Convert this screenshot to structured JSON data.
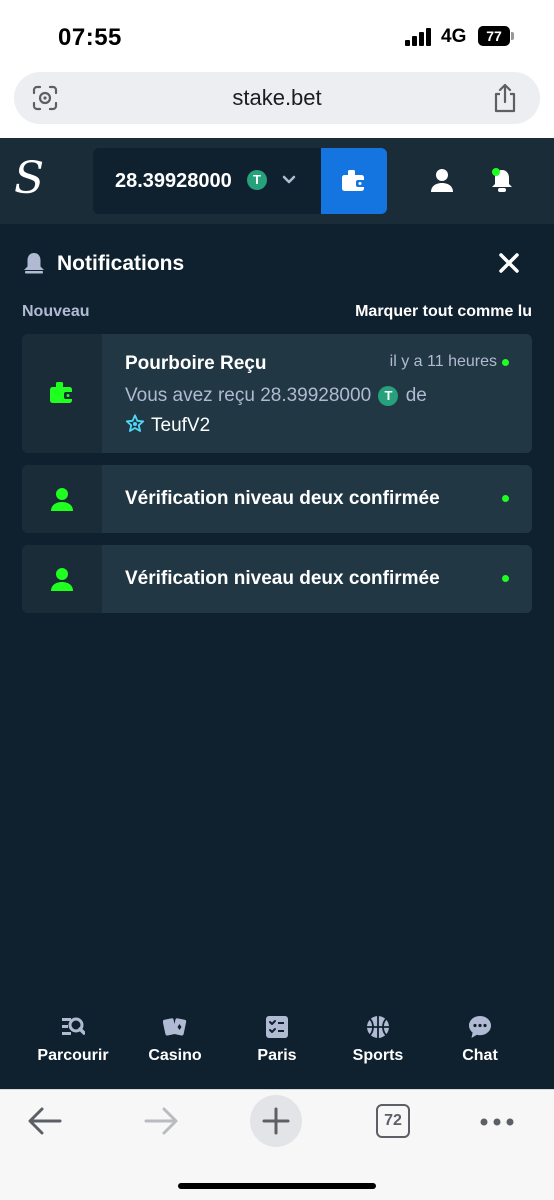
{
  "status_bar": {
    "time": "07:55",
    "network": "4G",
    "battery": "77"
  },
  "browser": {
    "url": "stake.bet",
    "tab_count": "72"
  },
  "header": {
    "logo": "S",
    "balance": "28.39928000",
    "currency_symbol": "T"
  },
  "notifications": {
    "title": "Notifications",
    "section_label": "Nouveau",
    "mark_all_read": "Marquer tout comme lu",
    "items": [
      {
        "title": "Pourboire Reçu",
        "time": "il y a 11 heures",
        "body_prefix": "Vous avez reçu 28.39928000",
        "body_suffix": "de",
        "sender": "TeufV2"
      },
      {
        "title": "Vérification niveau deux confirmée"
      },
      {
        "title": "Vérification niveau deux confirmée"
      }
    ]
  },
  "bottom_nav": [
    {
      "label": "Parcourir",
      "icon": "browse-icon"
    },
    {
      "label": "Casino",
      "icon": "cards-icon"
    },
    {
      "label": "Paris",
      "icon": "bets-icon"
    },
    {
      "label": "Sports",
      "icon": "basketball-icon"
    },
    {
      "label": "Chat",
      "icon": "chat-icon"
    }
  ],
  "colors": {
    "background": "#0f212e",
    "panel": "#1a2c38",
    "card": "#213743",
    "accent_blue": "#1475e1",
    "accent_green": "#1fff20",
    "tether_green": "#26a17b"
  }
}
